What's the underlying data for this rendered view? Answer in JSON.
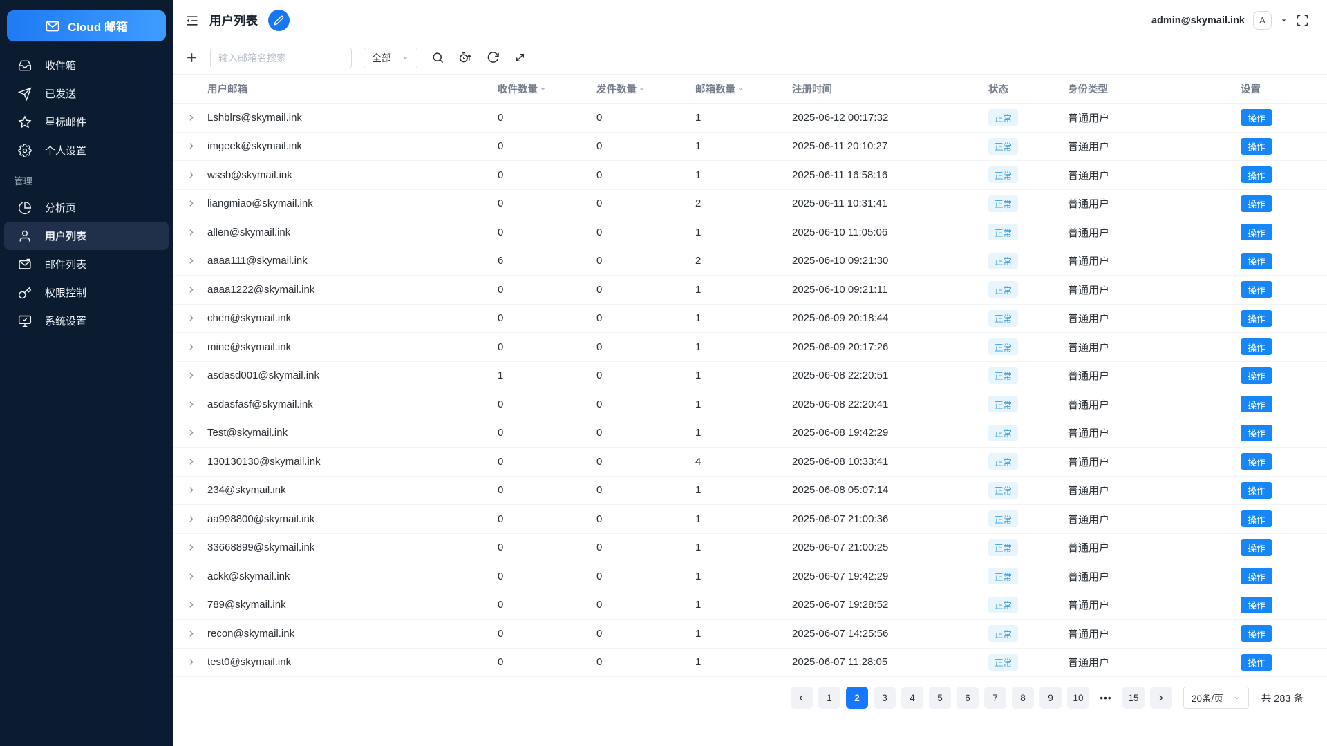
{
  "app": {
    "logo_text": "Cloud 邮箱"
  },
  "sidebar": {
    "main_items": [
      "收件箱",
      "已发送",
      "星标邮件",
      "个人设置"
    ],
    "section_label": "管理",
    "admin_items": [
      "分析页",
      "用户列表",
      "邮件列表",
      "权限控制",
      "系统设置"
    ]
  },
  "header": {
    "title": "用户列表",
    "account": "admin@skymail.ink",
    "avatar_letter": "A"
  },
  "toolbar": {
    "search_placeholder": "输入邮箱名搜索",
    "filter_value": "全部"
  },
  "table": {
    "columns": {
      "email": "用户邮箱",
      "recv": "收件数量",
      "sent": "发件数量",
      "boxes": "邮箱数量",
      "time": "注册时间",
      "status": "状态",
      "role": "身份类型",
      "settings": "设置"
    },
    "rows": [
      {
        "email": "Lshblrs@skymail.ink",
        "recv": "0",
        "sent": "0",
        "boxes": "1",
        "time": "2025-06-12 00:17:32",
        "status": "正常",
        "role": "普通用户",
        "action": "操作"
      },
      {
        "email": "imgeek@skymail.ink",
        "recv": "0",
        "sent": "0",
        "boxes": "1",
        "time": "2025-06-11 20:10:27",
        "status": "正常",
        "role": "普通用户",
        "action": "操作"
      },
      {
        "email": "wssb@skymail.ink",
        "recv": "0",
        "sent": "0",
        "boxes": "1",
        "time": "2025-06-11 16:58:16",
        "status": "正常",
        "role": "普通用户",
        "action": "操作"
      },
      {
        "email": "liangmiao@skymail.ink",
        "recv": "0",
        "sent": "0",
        "boxes": "2",
        "time": "2025-06-11 10:31:41",
        "status": "正常",
        "role": "普通用户",
        "action": "操作"
      },
      {
        "email": "allen@skymail.ink",
        "recv": "0",
        "sent": "0",
        "boxes": "1",
        "time": "2025-06-10 11:05:06",
        "status": "正常",
        "role": "普通用户",
        "action": "操作"
      },
      {
        "email": "aaaa111@skymail.ink",
        "recv": "6",
        "sent": "0",
        "boxes": "2",
        "time": "2025-06-10 09:21:30",
        "status": "正常",
        "role": "普通用户",
        "action": "操作"
      },
      {
        "email": "aaaa1222@skymail.ink",
        "recv": "0",
        "sent": "0",
        "boxes": "1",
        "time": "2025-06-10 09:21:11",
        "status": "正常",
        "role": "普通用户",
        "action": "操作"
      },
      {
        "email": "chen@skymail.ink",
        "recv": "0",
        "sent": "0",
        "boxes": "1",
        "time": "2025-06-09 20:18:44",
        "status": "正常",
        "role": "普通用户",
        "action": "操作"
      },
      {
        "email": "mine@skymail.ink",
        "recv": "0",
        "sent": "0",
        "boxes": "1",
        "time": "2025-06-09 20:17:26",
        "status": "正常",
        "role": "普通用户",
        "action": "操作"
      },
      {
        "email": "asdasd001@skymail.ink",
        "recv": "1",
        "sent": "0",
        "boxes": "1",
        "time": "2025-06-08 22:20:51",
        "status": "正常",
        "role": "普通用户",
        "action": "操作"
      },
      {
        "email": "asdasfasf@skymail.ink",
        "recv": "0",
        "sent": "0",
        "boxes": "1",
        "time": "2025-06-08 22:20:41",
        "status": "正常",
        "role": "普通用户",
        "action": "操作"
      },
      {
        "email": "Test@skymail.ink",
        "recv": "0",
        "sent": "0",
        "boxes": "1",
        "time": "2025-06-08 19:42:29",
        "status": "正常",
        "role": "普通用户",
        "action": "操作"
      },
      {
        "email": "130130130@skymail.ink",
        "recv": "0",
        "sent": "0",
        "boxes": "4",
        "time": "2025-06-08 10:33:41",
        "status": "正常",
        "role": "普通用户",
        "action": "操作"
      },
      {
        "email": "234@skymail.ink",
        "recv": "0",
        "sent": "0",
        "boxes": "1",
        "time": "2025-06-08 05:07:14",
        "status": "正常",
        "role": "普通用户",
        "action": "操作"
      },
      {
        "email": "aa998800@skymail.ink",
        "recv": "0",
        "sent": "0",
        "boxes": "1",
        "time": "2025-06-07 21:00:36",
        "status": "正常",
        "role": "普通用户",
        "action": "操作"
      },
      {
        "email": "33668899@skymail.ink",
        "recv": "0",
        "sent": "0",
        "boxes": "1",
        "time": "2025-06-07 21:00:25",
        "status": "正常",
        "role": "普通用户",
        "action": "操作"
      },
      {
        "email": "ackk@skymail.ink",
        "recv": "0",
        "sent": "0",
        "boxes": "1",
        "time": "2025-06-07 19:42:29",
        "status": "正常",
        "role": "普通用户",
        "action": "操作"
      },
      {
        "email": "789@skymail.ink",
        "recv": "0",
        "sent": "0",
        "boxes": "1",
        "time": "2025-06-07 19:28:52",
        "status": "正常",
        "role": "普通用户",
        "action": "操作"
      },
      {
        "email": "recon@skymail.ink",
        "recv": "0",
        "sent": "0",
        "boxes": "1",
        "time": "2025-06-07 14:25:56",
        "status": "正常",
        "role": "普通用户",
        "action": "操作"
      },
      {
        "email": "test0@skymail.ink",
        "recv": "0",
        "sent": "0",
        "boxes": "1",
        "time": "2025-06-07 11:28:05",
        "status": "正常",
        "role": "普通用户",
        "action": "操作"
      }
    ]
  },
  "pagination": {
    "pages": [
      {
        "label": "1"
      },
      {
        "label": "2",
        "active": true
      },
      {
        "label": "3"
      },
      {
        "label": "4"
      },
      {
        "label": "5"
      },
      {
        "label": "6"
      },
      {
        "label": "7"
      },
      {
        "label": "8"
      },
      {
        "label": "9"
      },
      {
        "label": "10"
      },
      {
        "label": "•••",
        "ellipsis": true
      },
      {
        "label": "15"
      }
    ],
    "page_size": "20条/页",
    "total": "共 283 条"
  },
  "colors": {
    "accent": "#1677ff",
    "sidebar_bg": "#0b1c30",
    "status_badge_bg": "#e9f5fd",
    "status_badge_text": "#3d9fe0",
    "action_button": "#1787f8"
  }
}
